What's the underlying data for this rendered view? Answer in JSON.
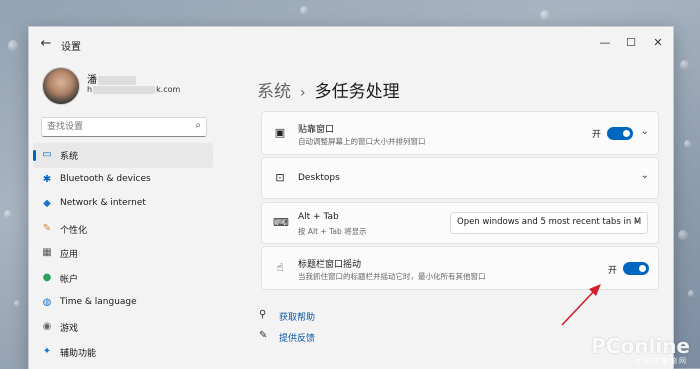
{
  "window": {
    "title": "设置",
    "controls": {
      "minimize": "—",
      "maximize": "☐",
      "close": "✕"
    }
  },
  "profile": {
    "name": "潘",
    "email_prefix": "h",
    "email_suffix": "k.com"
  },
  "search": {
    "placeholder": "查找设置"
  },
  "nav": {
    "items": [
      {
        "label": "系统",
        "icon": "display-icon",
        "active": true
      },
      {
        "label": "Bluetooth & devices",
        "icon": "bluetooth-icon"
      },
      {
        "label": "Network & internet",
        "icon": "wifi-icon"
      },
      {
        "label": "个性化",
        "icon": "brush-icon"
      },
      {
        "label": "应用",
        "icon": "apps-icon"
      },
      {
        "label": "帐户",
        "icon": "person-icon"
      },
      {
        "label": "Time & language",
        "icon": "globe-clock-icon"
      },
      {
        "label": "游戏",
        "icon": "gamepad-icon"
      },
      {
        "label": "辅助功能",
        "icon": "accessibility-icon"
      }
    ]
  },
  "breadcrumb": {
    "parent": "系统",
    "separator": "›",
    "current": "多任务处理"
  },
  "cards": {
    "snap": {
      "title": "贴靠窗口",
      "subtitle": "自动调整屏幕上的窗口大小并排列窗口",
      "toggle_label": "开",
      "toggle_on": true
    },
    "desktops": {
      "title": "Desktops"
    },
    "alttab": {
      "title": "Alt + Tab",
      "subtitle": "按 Alt + Tab 将显示",
      "dropdown_value": "Open windows and 5 most recent tabs in M"
    },
    "shake": {
      "title": "标题栏窗口摇动",
      "subtitle": "当我抓住窗口的标题栏并摇动它时，最小化所有其他窗口",
      "toggle_label": "开",
      "toggle_on": true
    }
  },
  "links": {
    "help": "获取帮助",
    "feedback": "提供反馈"
  },
  "watermark": {
    "brand": "PConline",
    "sub": "太平洋电脑网"
  },
  "colors": {
    "accent": "#0067c0",
    "arrow": "#d0202a"
  }
}
